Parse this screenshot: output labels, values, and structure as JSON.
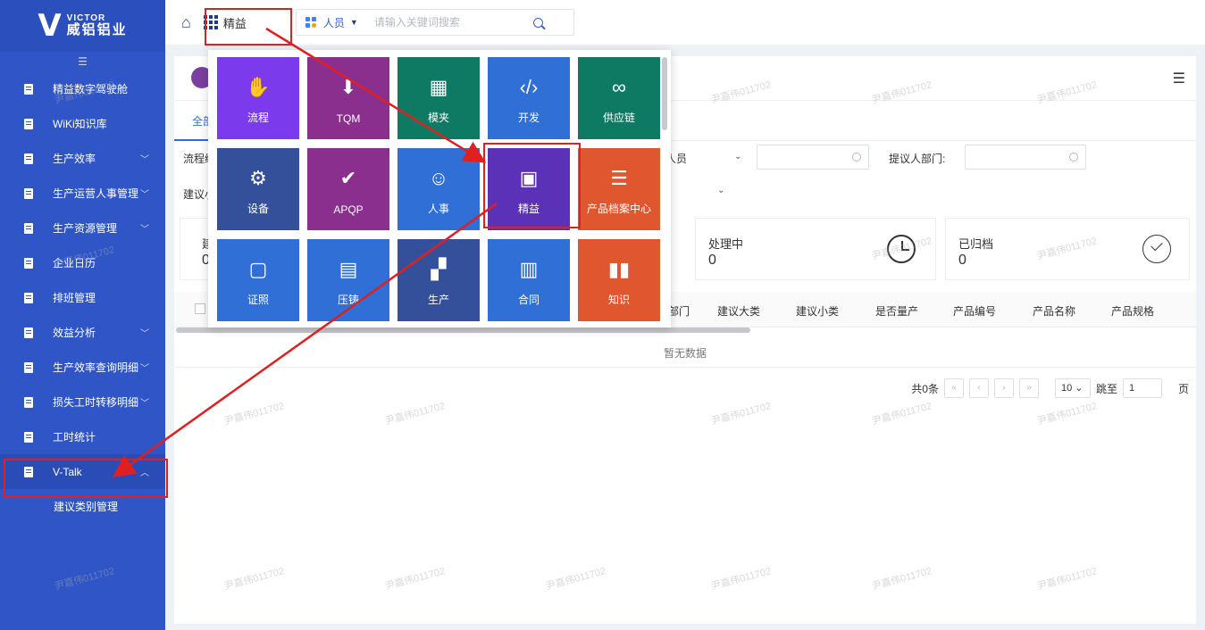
{
  "brand": {
    "en": "VICTOR",
    "cn": "威铝铝业"
  },
  "sidebar": {
    "collapse_icon": "fold-menu-icon",
    "items": [
      {
        "label": "精益数字驾驶舱",
        "has_children": false
      },
      {
        "label": "WiKi知识库",
        "has_children": false
      },
      {
        "label": "生产效率",
        "has_children": true
      },
      {
        "label": "生产运营人事管理",
        "has_children": true
      },
      {
        "label": "生产资源管理",
        "has_children": true
      },
      {
        "label": "企业日历",
        "has_children": false
      },
      {
        "label": "排班管理",
        "has_children": false
      },
      {
        "label": "效益分析",
        "has_children": true
      },
      {
        "label": "生产效率查询明细",
        "has_children": true
      },
      {
        "label": "损失工时转移明细",
        "has_children": true
      },
      {
        "label": "工时统计",
        "has_children": false
      },
      {
        "label": "V-Talk",
        "has_children": true,
        "expanded": true,
        "active": true
      }
    ],
    "sub_items": [
      {
        "label": "建议类别管理"
      }
    ]
  },
  "topbar": {
    "app_switcher_label": "精益",
    "search_type": "人员",
    "search_placeholder": "请输入关键词搜索"
  },
  "popup": {
    "tiles": [
      {
        "label": "流程",
        "icon": "workflow-icon",
        "color": "#7c3aed"
      },
      {
        "label": "TQM",
        "icon": "tqm-icon",
        "color": "#8b2f8f"
      },
      {
        "label": "模夹",
        "icon": "mold-icon",
        "color": "#0f7a63"
      },
      {
        "label": "开发",
        "icon": "code-icon",
        "color": "#2f6fd6"
      },
      {
        "label": "供应链",
        "icon": "link-icon",
        "color": "#0f7a63"
      },
      {
        "label": "设备",
        "icon": "equipment-icon",
        "color": "#34509a"
      },
      {
        "label": "APQP",
        "icon": "shield-check-icon",
        "color": "#8b2f8f"
      },
      {
        "label": "人事",
        "icon": "people-icon",
        "color": "#2f6fd6"
      },
      {
        "label": "精益",
        "icon": "box-gear-icon",
        "color": "#5b31b8"
      },
      {
        "label": "产品档案中心",
        "icon": "archive-icon",
        "color": "#e0562f"
      },
      {
        "label": "证照",
        "icon": "certificate-icon",
        "color": "#2f6fd6"
      },
      {
        "label": "压铸",
        "icon": "document-stack-icon",
        "color": "#2f6fd6"
      },
      {
        "label": "生产",
        "icon": "production-icon",
        "color": "#34509a"
      },
      {
        "label": "合同",
        "icon": "contract-icon",
        "color": "#2f6fd6"
      },
      {
        "label": "知识",
        "icon": "book-icon",
        "color": "#e0562f"
      }
    ]
  },
  "main": {
    "tab_all": "全部",
    "filters": {
      "process_label": "流程编",
      "person_select": "人员",
      "proposer_dept_label": "提议人部门:",
      "suggest_sub_label": "建议小"
    },
    "stats": [
      {
        "label": "建",
        "value": "0"
      },
      {
        "label": "处理中",
        "value": "0"
      },
      {
        "label": "已归档",
        "value": "0"
      }
    ],
    "table_columns": [
      "部门",
      "建议大类",
      "建议小类",
      "是否量产",
      "产品编号",
      "产品名称",
      "产品规格"
    ],
    "empty_text": "暂无数据",
    "pagination": {
      "total": "共0条",
      "page_size": "10",
      "jump_label": "跳至",
      "jump_value": "1",
      "page_suffix": "页"
    }
  },
  "watermark_text": "尹嘉伟011702"
}
